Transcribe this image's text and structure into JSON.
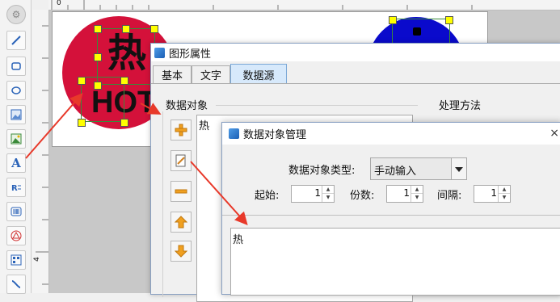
{
  "toolbar": {
    "tools": [
      "settings-icon",
      "line-tool-icon",
      "rectangle-tool-icon",
      "ellipse-tool-icon",
      "image-tool-icon",
      "picture-tool-icon",
      "text-tool-icon",
      "rich-text-tool-icon",
      "barcode-tool-icon",
      "warning-shape-icon",
      "qrcode-tool-icon",
      "curve-tool-icon"
    ],
    "text_tool_glyph": "A"
  },
  "ruler": {
    "top_mark": "0",
    "left_mark": "4"
  },
  "canvas": {
    "label_text_char": "热",
    "label_text_hot": "HOT",
    "circle_colors": [
      "#d4113a",
      "#0a0acc"
    ]
  },
  "dialog_shape_properties": {
    "title": "图形属性",
    "tabs": [
      "基本",
      "文字",
      "数据源"
    ],
    "active_tab": "数据源",
    "data_object_group": "数据对象",
    "data_object_item": "热",
    "process_group": "处理方法"
  },
  "dialog_data_object_manager": {
    "title": "数据对象管理",
    "close_glyph": "×",
    "type_label": "数据对象类型:",
    "type_value": "手动输入",
    "start_label": "起始:",
    "start_value": "1",
    "copies_label": "份数:",
    "copies_value": "1",
    "interval_label": "间隔:",
    "interval_value": "1",
    "content": "热"
  },
  "colors": {
    "arrow": "#e8392a",
    "accent": "#2a63b8"
  }
}
